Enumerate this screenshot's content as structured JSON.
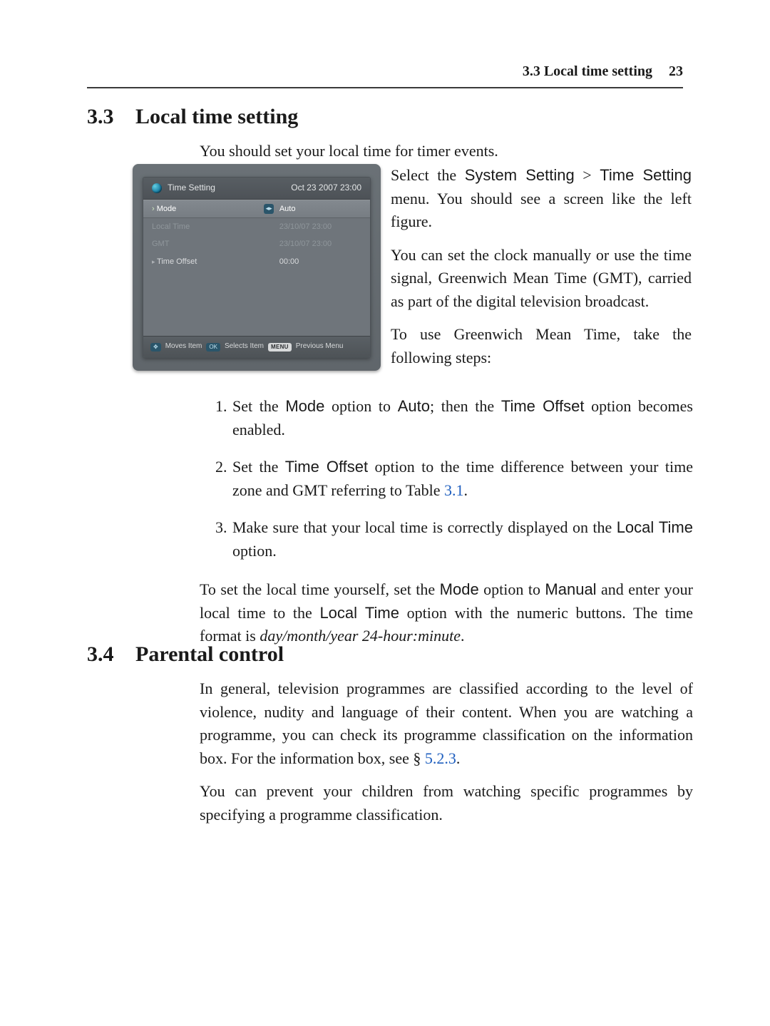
{
  "header": {
    "section_label": "3.3 Local time setting",
    "page_number": "23"
  },
  "sections": {
    "s33": {
      "num": "3.3",
      "title": "Local time setting"
    },
    "s34": {
      "num": "3.4",
      "title": "Parental control"
    }
  },
  "intro_line": "You should set your local time for timer events.",
  "right": {
    "p1a": "Select the ",
    "p1_menu1": "System Setting",
    "p1_gt": " > ",
    "p1_menu2": "Time Setting",
    "p1b": " menu. You should see a screen like the left figure.",
    "p2": "You can set the clock manually or use the time signal, Greenwich Mean Time (GMT), carried as part of the digital television broadcast.",
    "p3": "To use Greenwich Mean Time, take the following steps:"
  },
  "steps": {
    "s1a": "Set the ",
    "s1_mode": "Mode",
    "s1b": " option to ",
    "s1_auto": "Auto",
    "s1c": "; then the ",
    "s1_timeoffset": "Time Offset",
    "s1d": " option becomes enabled.",
    "s2a": "Set the ",
    "s2_timeoffset": "Time Offset",
    "s2b": " option to the time difference between your time zone and GMT referring to Table ",
    "s2_link": "3.1",
    "s2c": ".",
    "s3a": "Make sure that your local time is correctly displayed on the ",
    "s3_localtime": "Local Time",
    "s3b": " option."
  },
  "manual": {
    "a": "To set the local time yourself, set the ",
    "mode": "Mode",
    "b": " option to ",
    "manual": "Manual",
    "c": " and enter your local time to the ",
    "localtime": "Local Time",
    "d": " option with the numeric buttons. The time format is ",
    "fmt": "day/month/year 24-hour:minute",
    "e": "."
  },
  "s34_body": {
    "p1a": "In general, television programmes are classified according to the level of violence, nudity and language of their content. When you are watching a programme, you can check its programme classification on the information box. For the information box, see § ",
    "p1_link": "5.2.3",
    "p1b": ".",
    "p2": "You can prevent your children from watching specific programmes by specifying a programme classification."
  },
  "device": {
    "title": "Time Setting",
    "datetime": "Oct 23 2007 23:00",
    "rows": {
      "mode": {
        "label": "Mode",
        "value": "Auto"
      },
      "local_time": {
        "label": "Local Time",
        "value": "23/10/07 23:00"
      },
      "gmt": {
        "label": "GMT",
        "value": "23/10/07 23:00"
      },
      "offset": {
        "label": "Time Offset",
        "value": "00:00"
      }
    },
    "footer": {
      "moves": "Moves Item",
      "selects": "Selects Item",
      "menu_label": "MENU",
      "prev": "Previous Menu"
    }
  }
}
